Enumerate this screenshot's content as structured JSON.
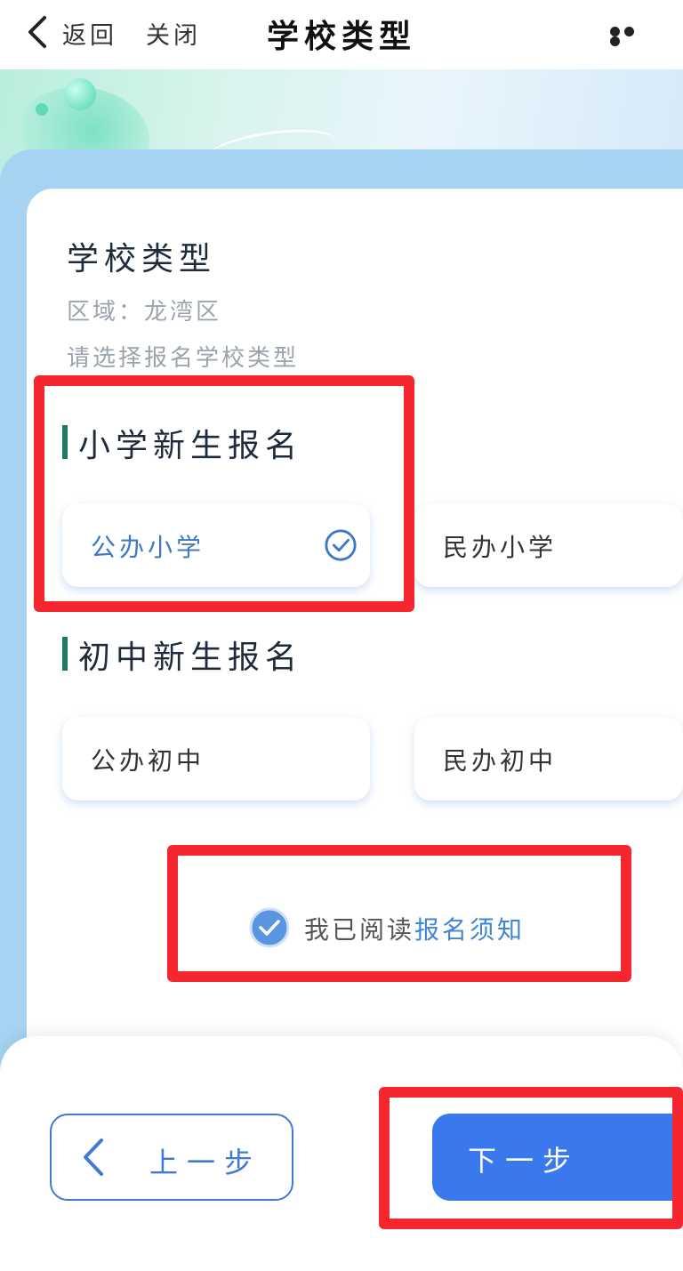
{
  "nav": {
    "back_label": "返回",
    "close_label": "关闭",
    "title": "学校类型"
  },
  "card": {
    "title": "学校类型",
    "region": "区域：龙湾区",
    "hint": "请选择报名学校类型"
  },
  "sections": [
    {
      "title": "小学新生报名",
      "options": [
        {
          "label": "公办小学",
          "selected": true
        },
        {
          "label": "民办小学",
          "selected": false
        }
      ]
    },
    {
      "title": "初中新生报名",
      "options": [
        {
          "label": "公办初中",
          "selected": false
        },
        {
          "label": "民办初中",
          "selected": false
        }
      ]
    }
  ],
  "agreement": {
    "prefix": "我已阅读",
    "link": "报名须知",
    "checked": true
  },
  "footer": {
    "prev_label": "上一步",
    "next_label": "下一步"
  },
  "colors": {
    "accent": "#3a78ee",
    "section_bar": "#1a7a62",
    "annotation": "#f5262e"
  }
}
